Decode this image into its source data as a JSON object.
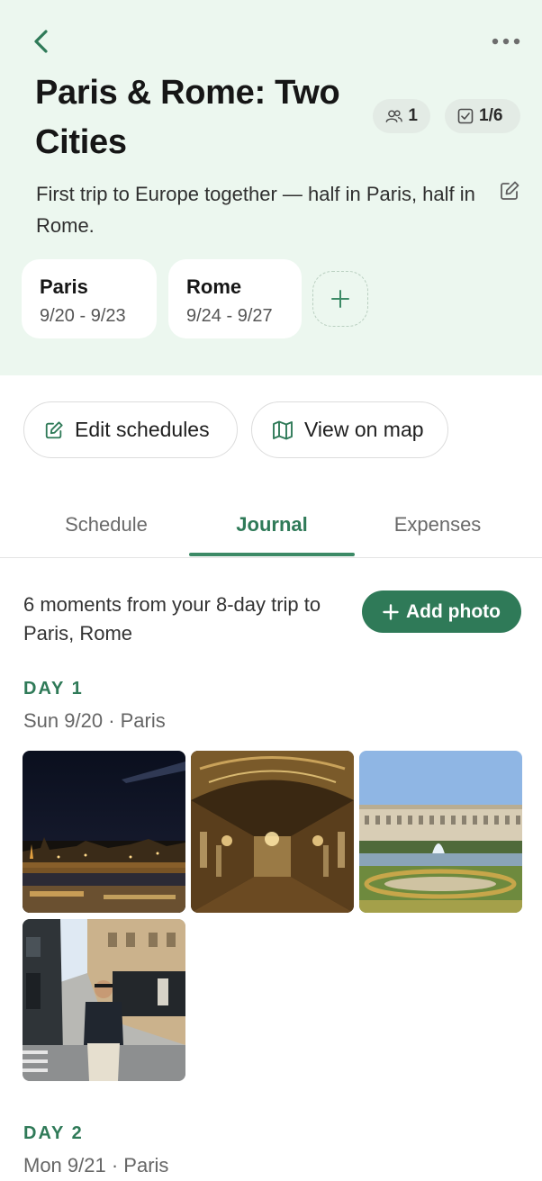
{
  "trip": {
    "title": "Paris & Rome: Two Cities",
    "travelers_count": "1",
    "tasks_progress": "1/6",
    "description": "First trip to Europe together — half in Paris, half in Rome.",
    "cities": [
      {
        "name": "Paris",
        "dates": "9/20 - 9/23"
      },
      {
        "name": "Rome",
        "dates": "9/24 - 9/27"
      }
    ]
  },
  "actions": {
    "edit_schedules": "Edit schedules",
    "view_on_map": "View on map"
  },
  "tabs": [
    {
      "label": "Schedule",
      "active": false
    },
    {
      "label": "Journal",
      "active": true
    },
    {
      "label": "Expenses",
      "active": false
    }
  ],
  "journal": {
    "summary": "6 moments from your 8-day trip to Paris, Rome",
    "add_photo_label": "Add photo",
    "days": [
      {
        "label": "DAY 1",
        "date": "Sun 9/20 · Paris",
        "photos": [
          "night-city-skyline-photo",
          "hall-of-mirrors-photo",
          "palace-garden-fountain-photo",
          "street-portrait-photo"
        ]
      },
      {
        "label": "DAY 2",
        "date": "Mon 9/21 · Paris",
        "photos": []
      }
    ]
  },
  "colors": {
    "header_bg": "#ecf7ef",
    "accent": "#2f7a58",
    "pill_bg": "#e3ebe5"
  }
}
